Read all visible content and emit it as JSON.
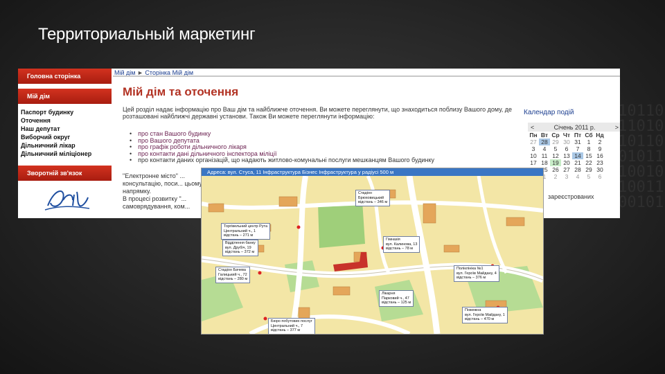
{
  "slide": {
    "title": "Территориальный маркетинг",
    "background_binary": "1010110100110101100101101001010110101001011010010101101001101011001010110100101011010100101101001010110100110101100101101001010110"
  },
  "sidebar": {
    "items": [
      {
        "label": "Головна сторінка"
      },
      {
        "label": "Мій дім"
      }
    ],
    "links": [
      "Паспорт будинку",
      "Оточення",
      "Наш депутат",
      "Виборчий округ",
      "Дільничний лікар",
      "Дільничний міліціонер"
    ],
    "feedback": "Зворотній зв'язок"
  },
  "breadcrumb": {
    "first": "Мій дім",
    "sep": "►",
    "second": "Сторінка Мій дім"
  },
  "page": {
    "heading": "Мій дім та оточення",
    "intro": "Цей розділ надає інформацію про Ваш дім та найближче оточення. Ви можете переглянути, що знаходиться поблизу Вашого дому, де розташовані найближчі державні установи. Також Ви можете переглянути інформацію:",
    "bullets": [
      "про стан Вашого будинку",
      "про Вашого депутата",
      "про графік роботи дільничного лікаря",
      "про контакти дані дільничного інспектора міліції",
      "про контакти даних організацій, що надають житлово-комунальні послуги мешканцям Вашого будинку"
    ],
    "para2": "\"Електронне місто\" ... консультацію, поси... цьому напрямку.",
    "para3": "В процесі розвитку \"... самоврядування, ком...",
    "registered": "зареєстрованих"
  },
  "calendar": {
    "link": "Календар подій",
    "month": "Січень 2011 р.",
    "prev": "<",
    "next": ">",
    "dow": [
      "Пн",
      "Вт",
      "Ср",
      "Чт",
      "Пт",
      "Сб",
      "Нд"
    ],
    "weeks": [
      [
        "27",
        "28",
        "29",
        "30",
        "31",
        "1",
        "2"
      ],
      [
        "3",
        "4",
        "5",
        "6",
        "7",
        "8",
        "9"
      ],
      [
        "10",
        "11",
        "12",
        "13",
        "14",
        "15",
        "16"
      ],
      [
        "17",
        "18",
        "19",
        "20",
        "21",
        "22",
        "23"
      ],
      [
        "24",
        "25",
        "26",
        "27",
        "28",
        "29",
        "30"
      ],
      [
        "31",
        "1",
        "2",
        "3",
        "4",
        "5",
        "6"
      ]
    ]
  },
  "map": {
    "bar": "Адреса: вул. Стуса, 11  Інфраструктура  Бізнес  Інфраструктура у радіусі 500 м",
    "callouts": [
      {
        "name": "Стадіон\nБрюховицький\nвідстань – 346 м"
      },
      {
        "name": "Торгівельний центр Рута\nЦентральний ч., 1\nвідстань – 271 м"
      },
      {
        "name": "Відділення банку\nвул. Друбіч, 19\nвідстань – 372 м"
      },
      {
        "name": "Гімназія\nвул. Калинова, 13\nвідстань – 78 м"
      },
      {
        "name": "Стадіон Бачева\nГалицький ч., 72\nвідстань – 280 м"
      },
      {
        "name": "Поліклініка №1\nвул. Героїв Майдану, 4\nвідстань – 376 м"
      },
      {
        "name": "Лікарня\nПарковий ч., 47\nвідстань – 125 м"
      },
      {
        "name": "Пожежна\nвул. Героїв Майдану, 1\nвідстань – 470 м"
      },
      {
        "name": "Бюро побутових послуг\nЦентральний ч., 7\nвідстань – 377 м"
      }
    ]
  }
}
